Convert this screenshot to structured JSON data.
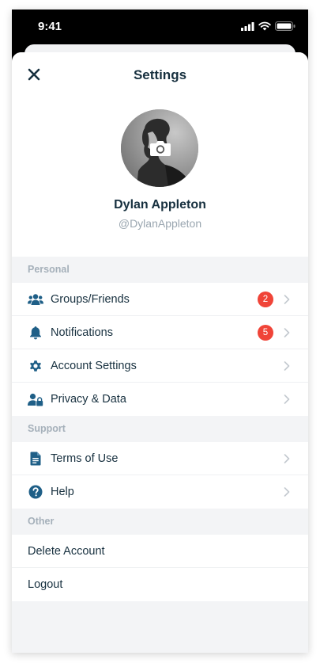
{
  "status_bar": {
    "time": "9:41"
  },
  "header": {
    "title": "Settings"
  },
  "profile": {
    "name": "Dylan Appleton",
    "handle": "@DylanAppleton"
  },
  "sections": {
    "personal": {
      "title": "Personal",
      "items": [
        {
          "label": "Groups/Friends",
          "icon": "users-icon",
          "badge": "2"
        },
        {
          "label": "Notifications",
          "icon": "bell-icon",
          "badge": "5"
        },
        {
          "label": "Account Settings",
          "icon": "gear-icon"
        },
        {
          "label": "Privacy & Data",
          "icon": "user-lock-icon"
        }
      ]
    },
    "support": {
      "title": "Support",
      "items": [
        {
          "label": "Terms of Use",
          "icon": "document-icon"
        },
        {
          "label": "Help",
          "icon": "question-icon"
        }
      ]
    },
    "other": {
      "title": "Other",
      "items": [
        {
          "label": "Delete Account"
        },
        {
          "label": "Logout"
        }
      ]
    }
  },
  "colors": {
    "text": "#17303f",
    "icon": "#1f5f87",
    "badge": "#f04438",
    "section_text": "#a5b0ba",
    "background": "#f3f4f6"
  }
}
